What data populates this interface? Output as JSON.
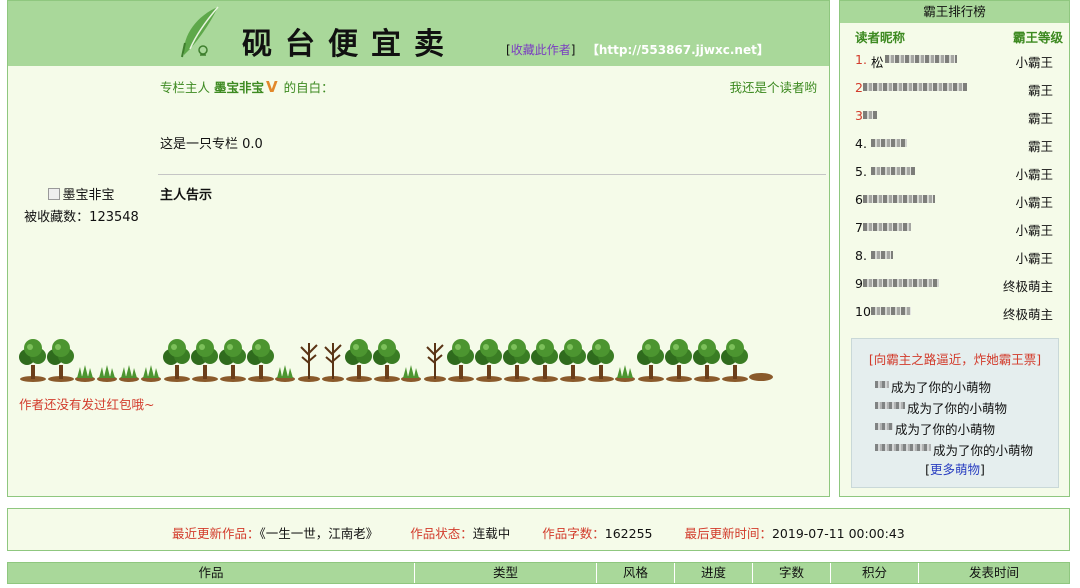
{
  "header": {
    "title": "砚台便宜卖",
    "bookmark_open": "[",
    "bookmark_label": "收藏此作者",
    "bookmark_close": "]",
    "url_label": "【http://553867.jjwxc.net】"
  },
  "author": {
    "owner_prefix": "专栏主人",
    "owner_name": "墨宝非宝",
    "v_badge": "V",
    "owner_suffix": "的自白：",
    "reader_note": "我还是个读者哟",
    "intro": "这是一只专栏 0.0",
    "notice_label": "主人告示",
    "avatar_alt": "墨宝非宝",
    "fav_count_label": "被收藏数：123548",
    "redpacket_note": "作者还没有发过红包哦~"
  },
  "ranking": {
    "title": "霸王排行榜",
    "col_nickname": "读者昵称",
    "col_level": "霸王等级",
    "rows": [
      {
        "num": "1.",
        "hot": true,
        "prefix": "松",
        "level": "小霸王"
      },
      {
        "num": "2",
        "hot": true,
        "prefix": "",
        "level": "霸王"
      },
      {
        "num": "3",
        "hot": true,
        "prefix": "",
        "level": "霸王"
      },
      {
        "num": "4.",
        "hot": false,
        "prefix": "",
        "level": "霸王"
      },
      {
        "num": "5.",
        "hot": false,
        "prefix": "",
        "level": "小霸王"
      },
      {
        "num": "6",
        "hot": false,
        "prefix": "",
        "level": "小霸王"
      },
      {
        "num": "7",
        "hot": false,
        "prefix": "",
        "level": "小霸王"
      },
      {
        "num": "8.",
        "hot": false,
        "prefix": "",
        "level": "小霸王"
      },
      {
        "num": "9",
        "hot": false,
        "prefix": "",
        "level": "终极萌主"
      },
      {
        "num": "10",
        "hot": false,
        "prefix": "",
        "level": "终极萌主"
      }
    ]
  },
  "vote": {
    "title": "[向霸主之路逼近，炸她霸王票]",
    "rows": [
      {
        "text": "成为了你的小萌物"
      },
      {
        "text": "成为了你的小萌物"
      },
      {
        "text": "成为了你的小萌物"
      },
      {
        "text": "成为了你的小萌物"
      }
    ],
    "more_open": "[",
    "more_label": "更多萌物",
    "more_close": "]"
  },
  "update": {
    "latest_label": "最近更新作品：",
    "latest_value": "《一生一世，江南老》",
    "status_label": "作品状态：",
    "status_value": "连载中",
    "words_label": "作品字数：",
    "words_value": "162255",
    "time_label": "最后更新时间：",
    "time_value": "2019-07-11 00:00:43"
  },
  "works_table": {
    "headers": [
      "作品",
      "类型",
      "风格",
      "进度",
      "字数",
      "积分",
      "发表时间"
    ]
  },
  "colors": {
    "band_green": "#a9d89a",
    "panel_bg": "#f5fbe9",
    "label_green": "#3d8a21",
    "accent_red": "#d23b2b",
    "link_blue": "#2a3fc1",
    "link_purple": "#7a3cc1"
  }
}
